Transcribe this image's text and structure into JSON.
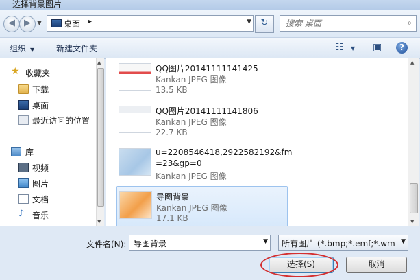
{
  "window": {
    "title": "选择背景图片"
  },
  "address": {
    "back_icon": "back-arrow-icon",
    "forward_icon": "forward-arrow-icon",
    "crumb": "桌面",
    "separator": "▸",
    "refresh_glyph": "↻",
    "search_placeholder": "搜索 桌面"
  },
  "toolbar": {
    "organize": "组织",
    "new_folder": "新建文件夹",
    "help": "?"
  },
  "nav": {
    "favorites": "收藏夹",
    "downloads": "下载",
    "desktop": "桌面",
    "recent": "最近访问的位置",
    "libraries": "库",
    "videos": "视频",
    "pictures": "图片",
    "documents": "文档",
    "music": "音乐"
  },
  "files": [
    {
      "name": "QQ图片20141111141425",
      "type": "Kankan JPEG 图像",
      "size": "13.5 KB"
    },
    {
      "name": "QQ图片20141111141806",
      "type": "Kankan JPEG 图像",
      "size": "22.7 KB"
    },
    {
      "name": "u=2208546418,2922582192&fm",
      "name2": "=23&gp=0",
      "type": "Kankan JPEG 图像"
    },
    {
      "name": "导图背景",
      "type": "Kankan JPEG 图像",
      "size": "17.1 KB",
      "selected": true
    }
  ],
  "bottom": {
    "filename_label": "文件名(N):",
    "filename_value": "导图背景",
    "filter": "所有图片 (*.bmp;*.emf;*.wmf;",
    "open_button": "选择(S)",
    "cancel_button": "取消"
  },
  "colors": {
    "selection": "#d6e8fb",
    "annotation_ring": "#d42f2f"
  }
}
